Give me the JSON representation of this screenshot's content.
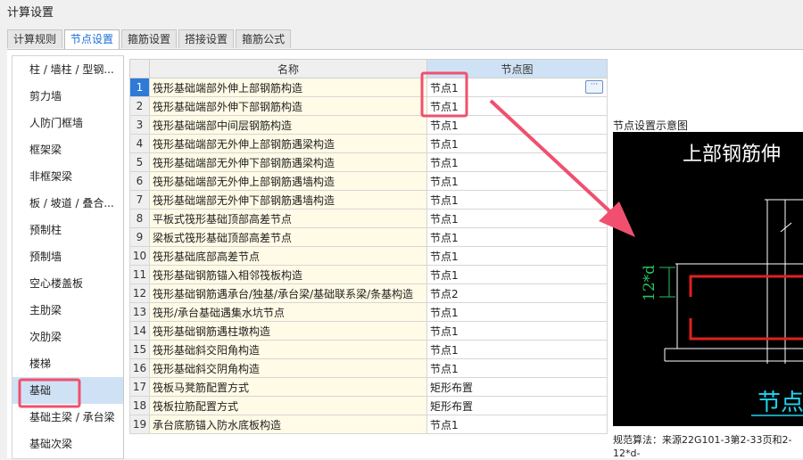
{
  "window": {
    "title": "计算设置"
  },
  "tabs": [
    {
      "label": "计算规则"
    },
    {
      "label": "节点设置"
    },
    {
      "label": "箍筋设置"
    },
    {
      "label": "搭接设置"
    },
    {
      "label": "箍筋公式"
    }
  ],
  "active_tab": 1,
  "sidebar": {
    "items": [
      {
        "label": "柱 / 墙柱 / 型钢..."
      },
      {
        "label": "剪力墙"
      },
      {
        "label": "人防门框墙"
      },
      {
        "label": "框架梁"
      },
      {
        "label": "非框架梁"
      },
      {
        "label": "板 / 坡道 / 叠合..."
      },
      {
        "label": "预制柱"
      },
      {
        "label": "预制墙"
      },
      {
        "label": "空心楼盖板"
      },
      {
        "label": "主肋梁"
      },
      {
        "label": "次肋梁"
      },
      {
        "label": "楼梯"
      },
      {
        "label": "基础"
      },
      {
        "label": "基础主梁 / 承台梁"
      },
      {
        "label": "基础次梁"
      }
    ],
    "selected": 12
  },
  "table": {
    "headers": {
      "name": "名称",
      "node": "节点图"
    },
    "rows": [
      {
        "num": "1",
        "name": "筏形基础端部外伸上部钢筋构造",
        "node": "节点1"
      },
      {
        "num": "2",
        "name": "筏形基础端部外伸下部钢筋构造",
        "node": "节点1"
      },
      {
        "num": "3",
        "name": "筏形基础端部中间层钢筋构造",
        "node": "节点1"
      },
      {
        "num": "4",
        "name": "筏形基础端部无外伸上部钢筋遇梁构造",
        "node": "节点1"
      },
      {
        "num": "5",
        "name": "筏形基础端部无外伸下部钢筋遇梁构造",
        "node": "节点1"
      },
      {
        "num": "6",
        "name": "筏形基础端部无外伸上部钢筋遇墙构造",
        "node": "节点1"
      },
      {
        "num": "7",
        "name": "筏形基础端部无外伸下部钢筋遇墙构造",
        "node": "节点1"
      },
      {
        "num": "8",
        "name": "平板式筏形基础顶部高差节点",
        "node": "节点1"
      },
      {
        "num": "9",
        "name": "梁板式筏形基础顶部高差节点",
        "node": "节点1"
      },
      {
        "num": "10",
        "name": "筏形基础底部高差节点",
        "node": "节点1"
      },
      {
        "num": "11",
        "name": "筏形基础钢筋锚入相邻筏板构造",
        "node": "节点1"
      },
      {
        "num": "12",
        "name": "筏形基础钢筋遇承台/独基/承台梁/基础联系梁/条基构造",
        "node": "节点2"
      },
      {
        "num": "13",
        "name": "筏形/承台基础遇集水坑节点",
        "node": "节点1"
      },
      {
        "num": "14",
        "name": "筏形基础钢筋遇柱墩构造",
        "node": "节点1"
      },
      {
        "num": "15",
        "name": "筏形基础斜交阳角构造",
        "node": "节点1"
      },
      {
        "num": "16",
        "name": "筏形基础斜交阴角构造",
        "node": "节点1"
      },
      {
        "num": "17",
        "name": "筏板马凳筋配置方式",
        "node": "矩形布置"
      },
      {
        "num": "18",
        "name": "筏板拉筋配置方式",
        "node": "矩形布置"
      },
      {
        "num": "19",
        "name": "承台底筋锚入防水底板构造",
        "node": "节点1"
      }
    ],
    "more_button": "···"
  },
  "preview": {
    "label": "节点设置示意图",
    "drawing_title": "上部钢筋伸",
    "dimension_text": "12*d",
    "bottom_text": "节点",
    "colors": {
      "background": "#000000",
      "rebar": "#e02020",
      "dimension": "#22c55e",
      "title": "#ffffff",
      "label": "#22d3ee"
    }
  },
  "note": {
    "line1": "规范算法：来源22G101-3第2-33页和2-",
    "line2": "12*d-"
  },
  "annotation": {
    "color": "#f0506e"
  }
}
